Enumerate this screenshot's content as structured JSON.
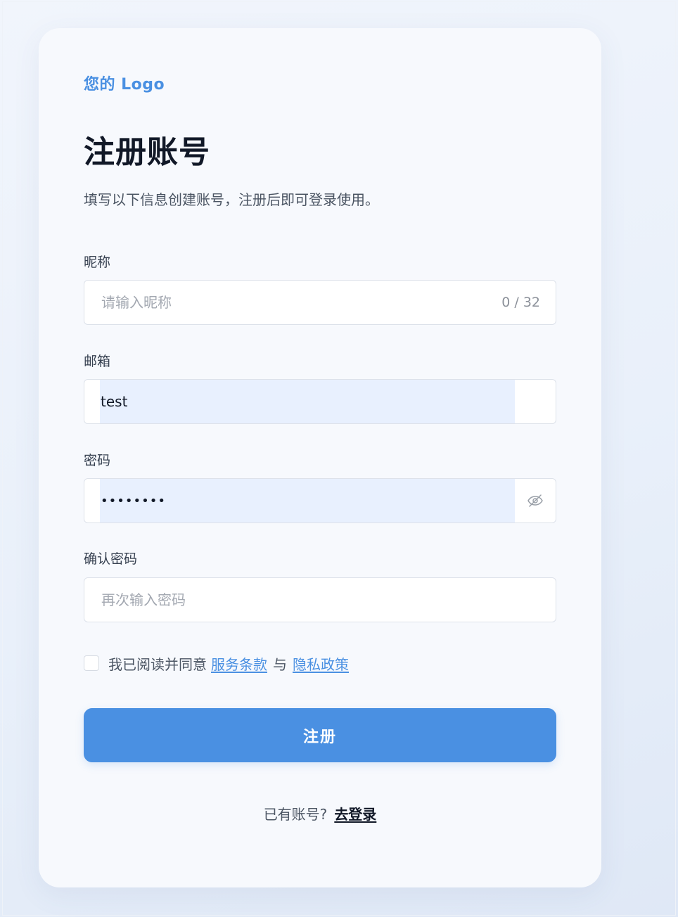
{
  "brand": {
    "logo_text": "您的 Logo",
    "accent_color": "#4a90e2"
  },
  "header": {
    "title": "注册账号",
    "subtitle": "填写以下信息创建账号，注册后即可登录使用。"
  },
  "form": {
    "nickname": {
      "label": "昵称",
      "placeholder": "请输入昵称",
      "value": "",
      "counter": "0 / 32"
    },
    "email": {
      "label": "邮箱",
      "value": "test"
    },
    "password": {
      "label": "密码",
      "value": "••••••••",
      "toggle_icon": "eye-off-icon"
    },
    "confirm_password": {
      "label": "确认密码",
      "placeholder": "再次输入密码",
      "value": ""
    },
    "agreement": {
      "checked": false,
      "prefix": "我已阅读并同意",
      "terms_link": "服务条款",
      "separator": "与",
      "privacy_link": "隐私政策"
    },
    "submit_label": "注册"
  },
  "footer": {
    "prompt": "已有账号?",
    "login_link": "去登录"
  }
}
